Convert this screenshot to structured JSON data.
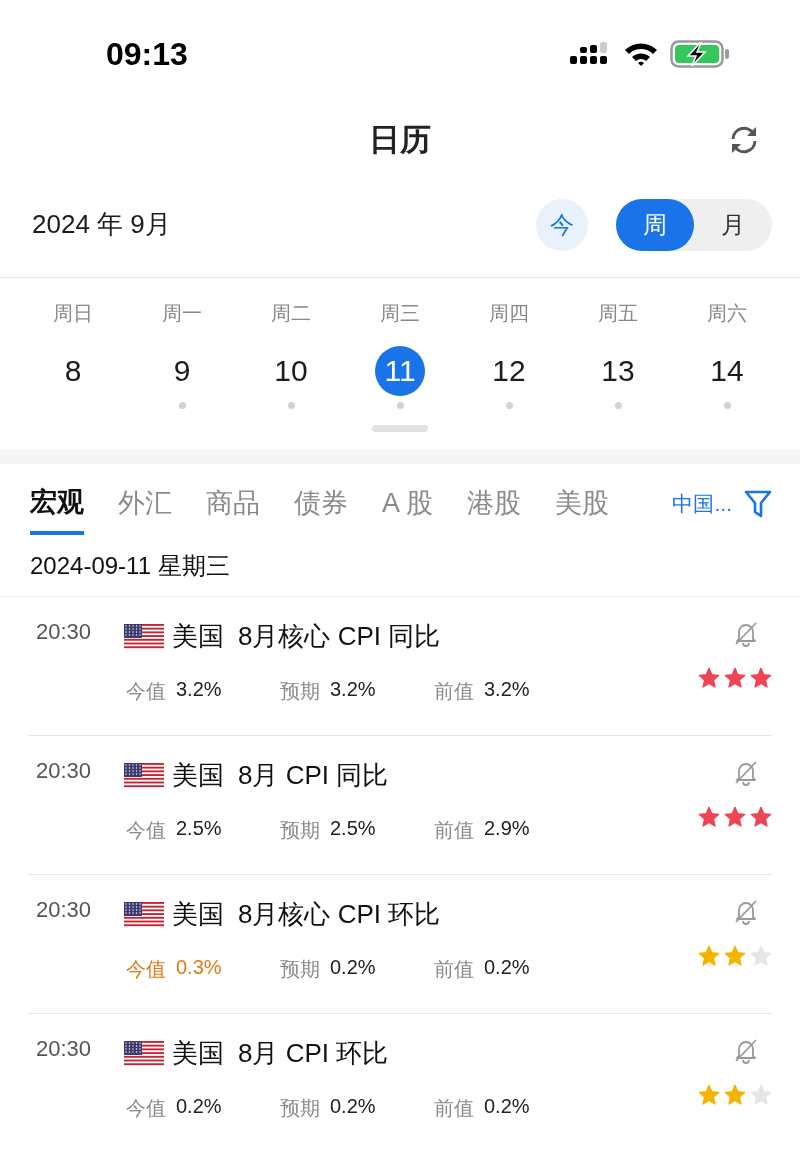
{
  "status_bar": {
    "time": "09:13"
  },
  "header": {
    "title": "日历"
  },
  "month_bar": {
    "month": "2024 年 9月",
    "today_button": "今",
    "view_toggle": [
      {
        "label": "周",
        "selected": true
      },
      {
        "label": "月",
        "selected": false
      }
    ]
  },
  "week": [
    {
      "weekday": "周日",
      "date": "8",
      "selected": false,
      "has_events": false
    },
    {
      "weekday": "周一",
      "date": "9",
      "selected": false,
      "has_events": true
    },
    {
      "weekday": "周二",
      "date": "10",
      "selected": false,
      "has_events": true
    },
    {
      "weekday": "周三",
      "date": "11",
      "selected": true,
      "has_events": true
    },
    {
      "weekday": "周四",
      "date": "12",
      "selected": false,
      "has_events": true
    },
    {
      "weekday": "周五",
      "date": "13",
      "selected": false,
      "has_events": true
    },
    {
      "weekday": "周六",
      "date": "14",
      "selected": false,
      "has_events": true
    }
  ],
  "category_tabs": [
    {
      "label": "宏观",
      "selected": true
    },
    {
      "label": "外汇",
      "selected": false
    },
    {
      "label": "商品",
      "selected": false
    },
    {
      "label": "债券",
      "selected": false
    },
    {
      "label": "A 股",
      "selected": false
    },
    {
      "label": "港股",
      "selected": false
    },
    {
      "label": "美股",
      "selected": false
    }
  ],
  "region_filter": "中国...",
  "date_heading": "2024-09-11 星期三",
  "events": [
    {
      "time": "20:30",
      "country": "美国",
      "title": "8月核心 CPI 同比",
      "actual_label": "今值",
      "actual": "3.2%",
      "actual_highlighted": false,
      "forecast_label": "预期",
      "forecast": "3.2%",
      "previous_label": "前值",
      "previous": "3.2%",
      "stars": 3
    },
    {
      "time": "20:30",
      "country": "美国",
      "title": "8月 CPI 同比",
      "actual_label": "今值",
      "actual": "2.5%",
      "actual_highlighted": false,
      "forecast_label": "预期",
      "forecast": "2.5%",
      "previous_label": "前值",
      "previous": "2.9%",
      "stars": 3
    },
    {
      "time": "20:30",
      "country": "美国",
      "title": "8月核心 CPI 环比",
      "actual_label": "今值",
      "actual": "0.3%",
      "actual_highlighted": true,
      "forecast_label": "预期",
      "forecast": "0.2%",
      "previous_label": "前值",
      "previous": "0.2%",
      "stars": 2
    },
    {
      "time": "20:30",
      "country": "美国",
      "title": "8月 CPI 环比",
      "actual_label": "今值",
      "actual": "0.2%",
      "actual_highlighted": false,
      "forecast_label": "预期",
      "forecast": "0.2%",
      "previous_label": "前值",
      "previous": "0.2%",
      "stars": 2
    }
  ]
}
